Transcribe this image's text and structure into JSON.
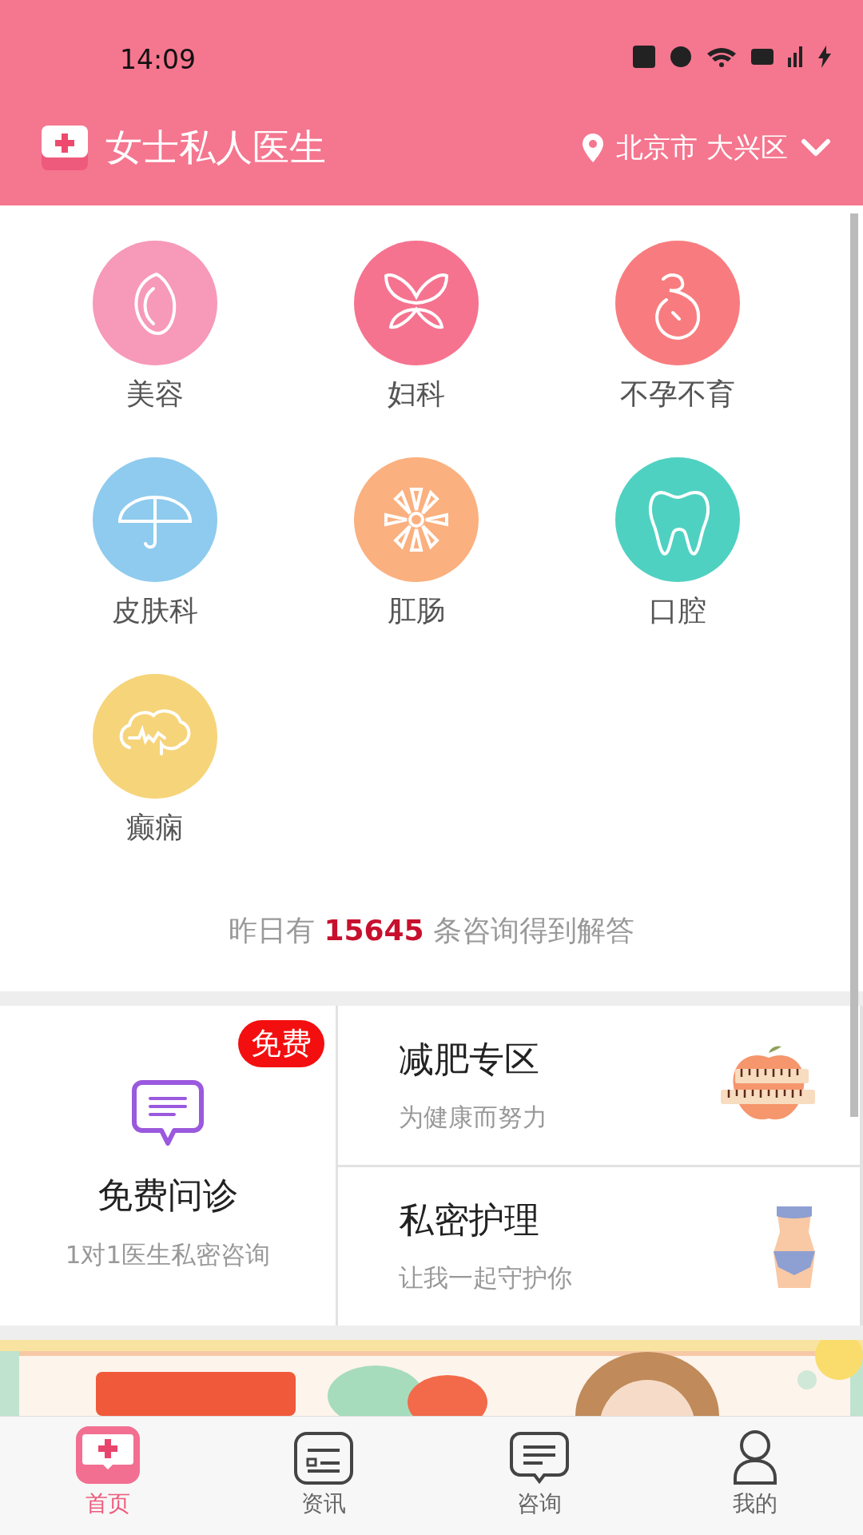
{
  "status_bar": {
    "time": "14:09"
  },
  "header": {
    "app_name": "女士私人医生",
    "location": "北京市 大兴区"
  },
  "categories": [
    {
      "label": "美容",
      "color": "#f799b8"
    },
    {
      "label": "妇科",
      "color": "#f5738f"
    },
    {
      "label": "不孕不育",
      "color": "#f87c7f"
    },
    {
      "label": "皮肤科",
      "color": "#8ecbee"
    },
    {
      "label": "肛肠",
      "color": "#fbb07f"
    },
    {
      "label": "口腔",
      "color": "#4fd1c1"
    },
    {
      "label": "癫痫",
      "color": "#f6d47a"
    }
  ],
  "stats": "昨日有 **15645** 条咨询得到解答",
  "free_consult": {
    "badge": "免费",
    "title": "免费问诊",
    "subtitle": "1对1医生私密咨询"
  },
  "promos": [
    {
      "title": "减肥专区",
      "subtitle": "为健康而努力"
    },
    {
      "title": "私密护理",
      "subtitle": "让我一起守护你"
    }
  ],
  "bottom_nav": [
    {
      "label": "首页",
      "selected": true
    },
    {
      "label": "资讯",
      "selected": false
    },
    {
      "label": "咨询",
      "selected": false
    },
    {
      "label": "我的",
      "selected": false
    }
  ]
}
